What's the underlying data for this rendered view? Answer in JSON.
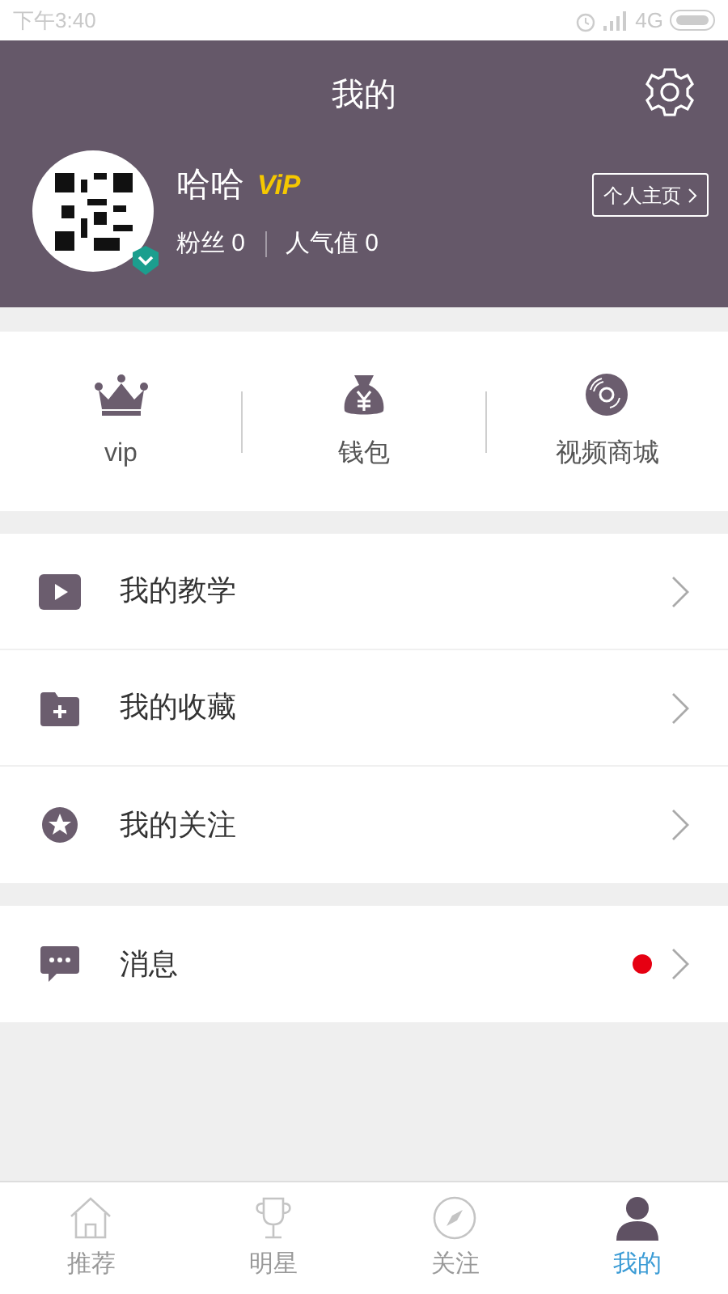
{
  "status_bar": {
    "time": "下午3:40",
    "network": "4G"
  },
  "header": {
    "title": "我的"
  },
  "profile": {
    "name": "哈哈",
    "badge": "ViP",
    "verified": true,
    "fans_label": "粉丝",
    "fans": "0",
    "popularity_label": "人气值",
    "popularity": "0",
    "homepage_button": "个人主页"
  },
  "shortcuts": [
    {
      "kind": "crown",
      "label": "vip"
    },
    {
      "kind": "moneybag",
      "label": "钱包"
    },
    {
      "kind": "disc",
      "label": "视频商城"
    }
  ],
  "menu_groups": [
    [
      {
        "kind": "video",
        "label": "我的教学",
        "unread": false
      },
      {
        "kind": "folder",
        "label": "我的收藏",
        "unread": false
      },
      {
        "kind": "star",
        "label": "我的关注",
        "unread": false
      }
    ],
    [
      {
        "kind": "message",
        "label": "消息",
        "unread": true
      }
    ]
  ],
  "tabs": [
    {
      "kind": "home",
      "label": "推荐",
      "selected": false
    },
    {
      "kind": "trophy",
      "label": "明星",
      "selected": false
    },
    {
      "kind": "compass",
      "label": "关注",
      "selected": false
    },
    {
      "kind": "person",
      "label": "我的",
      "selected": true
    }
  ]
}
